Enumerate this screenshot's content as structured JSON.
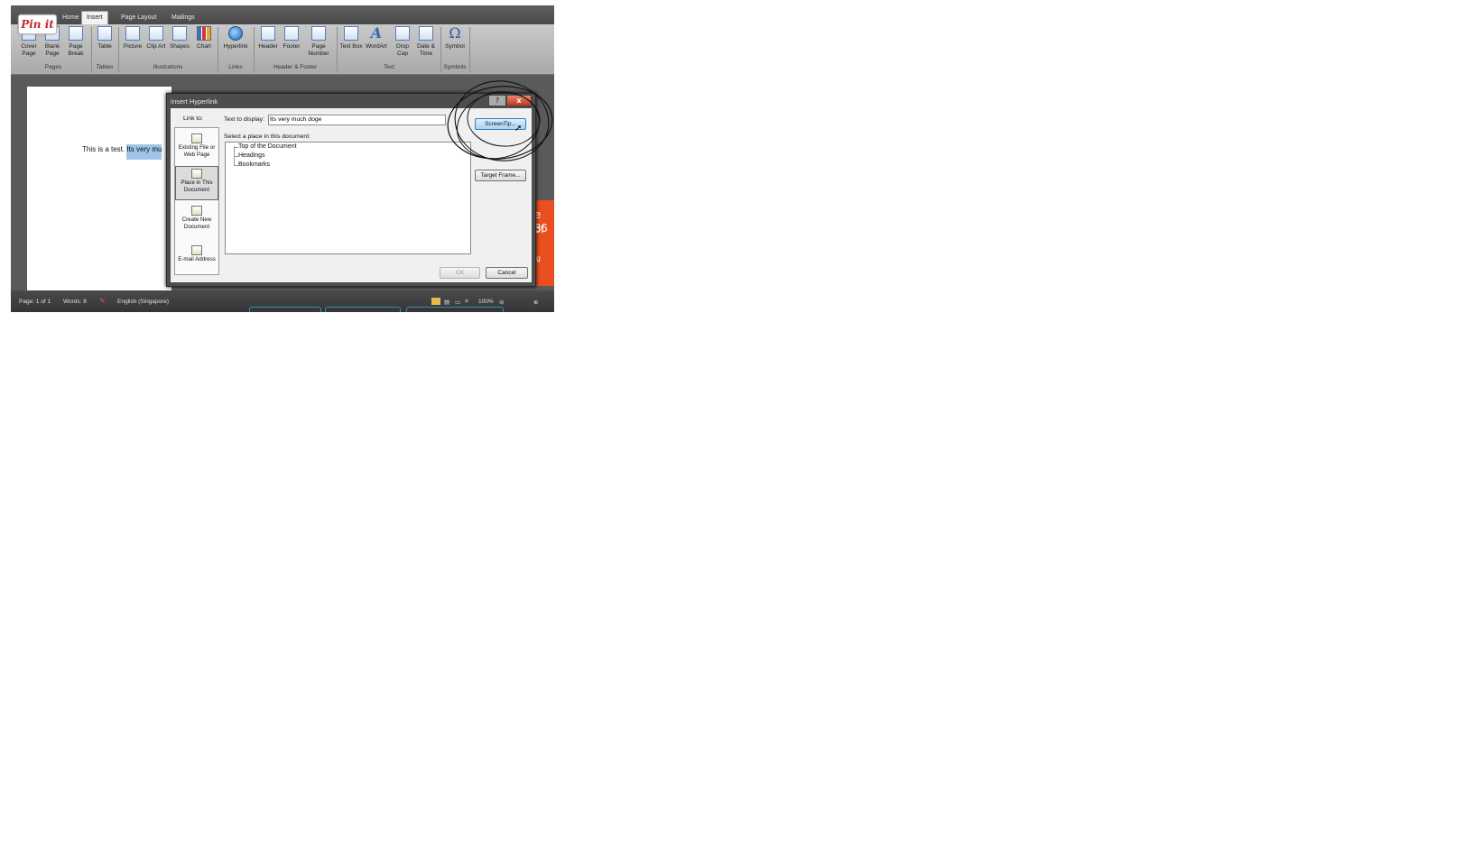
{
  "tabs": [
    "Home",
    "Insert",
    "Page Layout",
    "Mailings"
  ],
  "pinit_label": "Pin it",
  "ribbon": {
    "buttons": {
      "cover_page": "Cover Page",
      "blank_page": "Blank Page",
      "page_break": "Page Break",
      "table": "Table",
      "picture": "Picture",
      "clip_art": "Clip Art",
      "shapes": "Shapes",
      "chart": "Chart",
      "hyperlink": "Hyperlink",
      "header": "Header",
      "footer": "Footer",
      "page_number": "Page Number",
      "text_box": "Text Box",
      "wordart": "WordArt",
      "drop_cap": "Drop Cap",
      "date_time": "Date & Time",
      "symbol": "Symbol"
    },
    "groups": {
      "pages": "Pages",
      "tables": "Tables",
      "illustrations": "Illustrations",
      "links": "Links",
      "header_footer": "Header & Footer",
      "text": "Text",
      "symbols": "Symbols"
    }
  },
  "document": {
    "text_plain": "This is a test. ",
    "text_selected": "Its very mu"
  },
  "dialog": {
    "title": "Insert Hyperlink",
    "help": "?",
    "close": "x",
    "link_to_label": "Link to:",
    "link_to_items": [
      "Existing File or Web Page",
      "Place in This Document",
      "Create New Document",
      "E-mail Address"
    ],
    "text_to_display_label": "Text to display:",
    "text_to_display_value": "Its very much doge",
    "select_place_label": "Select a place in this document:",
    "tree_items": [
      "Top of the Document",
      "Headings",
      "Bookmarks"
    ],
    "screentip_button": "ScreenTip...",
    "target_frame_button": "Target Frame...",
    "ok_button": "OK",
    "cancel_button": "Cancel"
  },
  "status": {
    "page": "Page: 1 of 1",
    "words": "Words: 8",
    "language": "English (Singapore)",
    "zoom": "100%"
  },
  "orange_panel": {
    "line1": "e 36",
    "line2": "of",
    "line3": "ing"
  }
}
